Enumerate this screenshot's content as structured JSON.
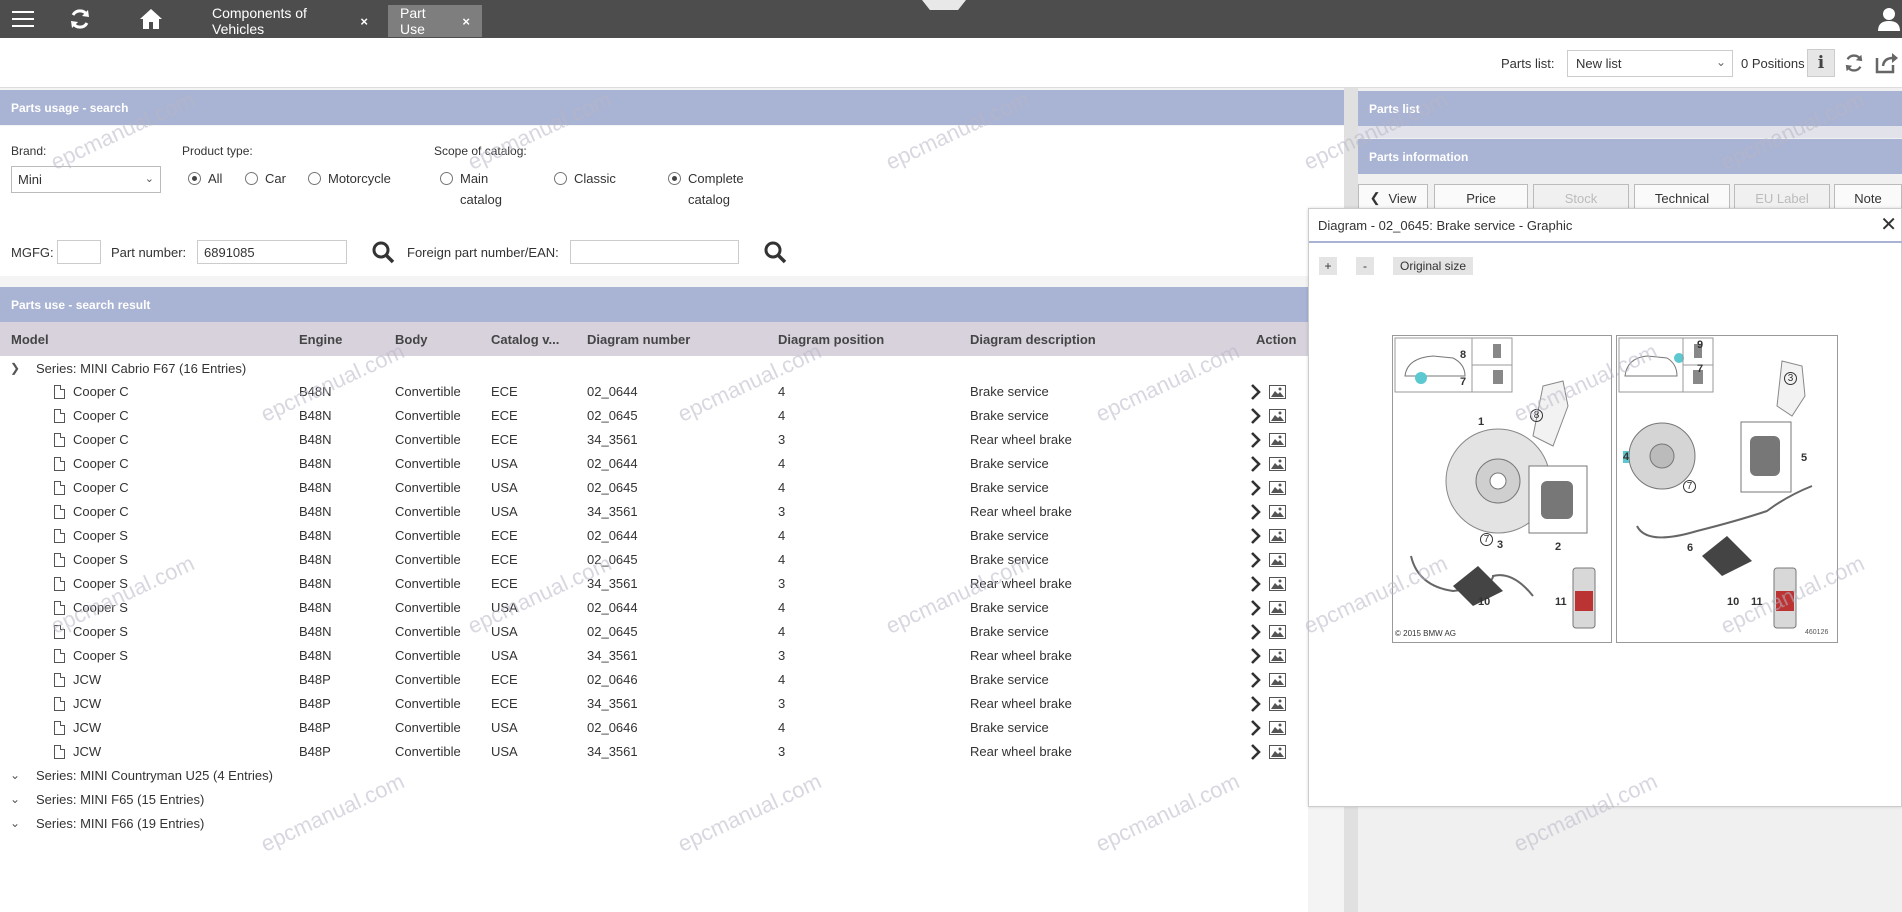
{
  "topbar": {
    "menu_icon": "hamburger-menu-icon",
    "refresh_icon": "refresh-icon",
    "home_icon": "home-icon",
    "tabs": [
      {
        "label": "Components of Vehicles",
        "close": "×"
      },
      {
        "label": "Part Use",
        "close": "×"
      }
    ],
    "user_icon": "user-icon"
  },
  "toolbar": {
    "parts_list_label": "Parts list:",
    "parts_list_value": "New list",
    "positions": "0 Positions",
    "info_icon": "info-icon",
    "reload_icon": "refresh-icon",
    "export_icon": "export-icon"
  },
  "search": {
    "header": "Parts usage - search",
    "brand_label": "Brand:",
    "brand_value": "Mini",
    "product_type_label": "Product type:",
    "product_types": [
      {
        "label": "All",
        "selected": true
      },
      {
        "label": "Car",
        "selected": false
      },
      {
        "label": "Motorcycle",
        "selected": false
      }
    ],
    "scope_label": "Scope of catalog:",
    "scopes": [
      {
        "line1": "Main",
        "line2": "catalog",
        "selected": false
      },
      {
        "line1": "Classic",
        "line2": "",
        "selected": false
      },
      {
        "line1": "Complete",
        "line2": "catalog",
        "selected": true
      }
    ],
    "mgfg_label": "MGFG:",
    "mgfg_value": "",
    "part_number_label": "Part number:",
    "part_number_value": "6891085",
    "foreign_label": "Foreign part number/EAN:",
    "foreign_value": ""
  },
  "results": {
    "header": "Parts use - search result",
    "columns": [
      "Model",
      "Engine",
      "Body",
      "Catalog v...",
      "Diagram number",
      "Diagram position",
      "Diagram description",
      "Action"
    ],
    "series": [
      {
        "label": "Series: MINI Cabrio F67 (16 Entries)",
        "expanded": true
      },
      {
        "label": "Series: MINI Countryman U25 (4 Entries)",
        "expanded": false
      },
      {
        "label": "Series: MINI F65 (15 Entries)",
        "expanded": false
      },
      {
        "label": "Series: MINI F66 (19 Entries)",
        "expanded": false
      }
    ],
    "rows": [
      [
        "Cooper C",
        "B48N",
        "Convertible",
        "ECE",
        "02_0644",
        "4",
        "Brake service"
      ],
      [
        "Cooper C",
        "B48N",
        "Convertible",
        "ECE",
        "02_0645",
        "4",
        "Brake service"
      ],
      [
        "Cooper C",
        "B48N",
        "Convertible",
        "ECE",
        "34_3561",
        "3",
        "Rear wheel brake"
      ],
      [
        "Cooper C",
        "B48N",
        "Convertible",
        "USA",
        "02_0644",
        "4",
        "Brake service"
      ],
      [
        "Cooper C",
        "B48N",
        "Convertible",
        "USA",
        "02_0645",
        "4",
        "Brake service"
      ],
      [
        "Cooper C",
        "B48N",
        "Convertible",
        "USA",
        "34_3561",
        "3",
        "Rear wheel brake"
      ],
      [
        "Cooper S",
        "B48N",
        "Convertible",
        "ECE",
        "02_0644",
        "4",
        "Brake service"
      ],
      [
        "Cooper S",
        "B48N",
        "Convertible",
        "ECE",
        "02_0645",
        "4",
        "Brake service"
      ],
      [
        "Cooper S",
        "B48N",
        "Convertible",
        "ECE",
        "34_3561",
        "3",
        "Rear wheel brake"
      ],
      [
        "Cooper S",
        "B48N",
        "Convertible",
        "USA",
        "02_0644",
        "4",
        "Brake service"
      ],
      [
        "Cooper S",
        "B48N",
        "Convertible",
        "USA",
        "02_0645",
        "4",
        "Brake service"
      ],
      [
        "Cooper S",
        "B48N",
        "Convertible",
        "USA",
        "34_3561",
        "3",
        "Rear wheel brake"
      ],
      [
        "JCW",
        "B48P",
        "Convertible",
        "ECE",
        "02_0646",
        "4",
        "Brake service"
      ],
      [
        "JCW",
        "B48P",
        "Convertible",
        "ECE",
        "34_3561",
        "3",
        "Rear wheel brake"
      ],
      [
        "JCW",
        "B48P",
        "Convertible",
        "USA",
        "02_0646",
        "4",
        "Brake service"
      ],
      [
        "JCW",
        "B48P",
        "Convertible",
        "USA",
        "34_3561",
        "3",
        "Rear wheel brake"
      ]
    ]
  },
  "right_panel": {
    "parts_list_header": "Parts list",
    "parts_info_header": "Parts information",
    "buttons": [
      {
        "label": "View",
        "disabled": false
      },
      {
        "label": "Price",
        "disabled": false
      },
      {
        "label": "Stock",
        "disabled": true
      },
      {
        "label": "Technical",
        "disabled": false
      },
      {
        "label": "EU Label",
        "disabled": true
      },
      {
        "label": "Note",
        "disabled": false
      }
    ]
  },
  "diagram": {
    "title": "Diagram - 02_0645: Brake service - Graphic",
    "zoom_in": "+",
    "zoom_out": "-",
    "original_size": "Original size",
    "copyright": "© 2015 BMW AG",
    "image_number": "460126",
    "left_callouts": [
      "8",
      "7",
      "8",
      "1",
      "7",
      "2",
      "3",
      "10",
      "11"
    ],
    "right_callouts": [
      "9",
      "7",
      "3",
      "4",
      "7",
      "5",
      "6",
      "10",
      "11"
    ]
  },
  "watermark": "epcmanual.com"
}
